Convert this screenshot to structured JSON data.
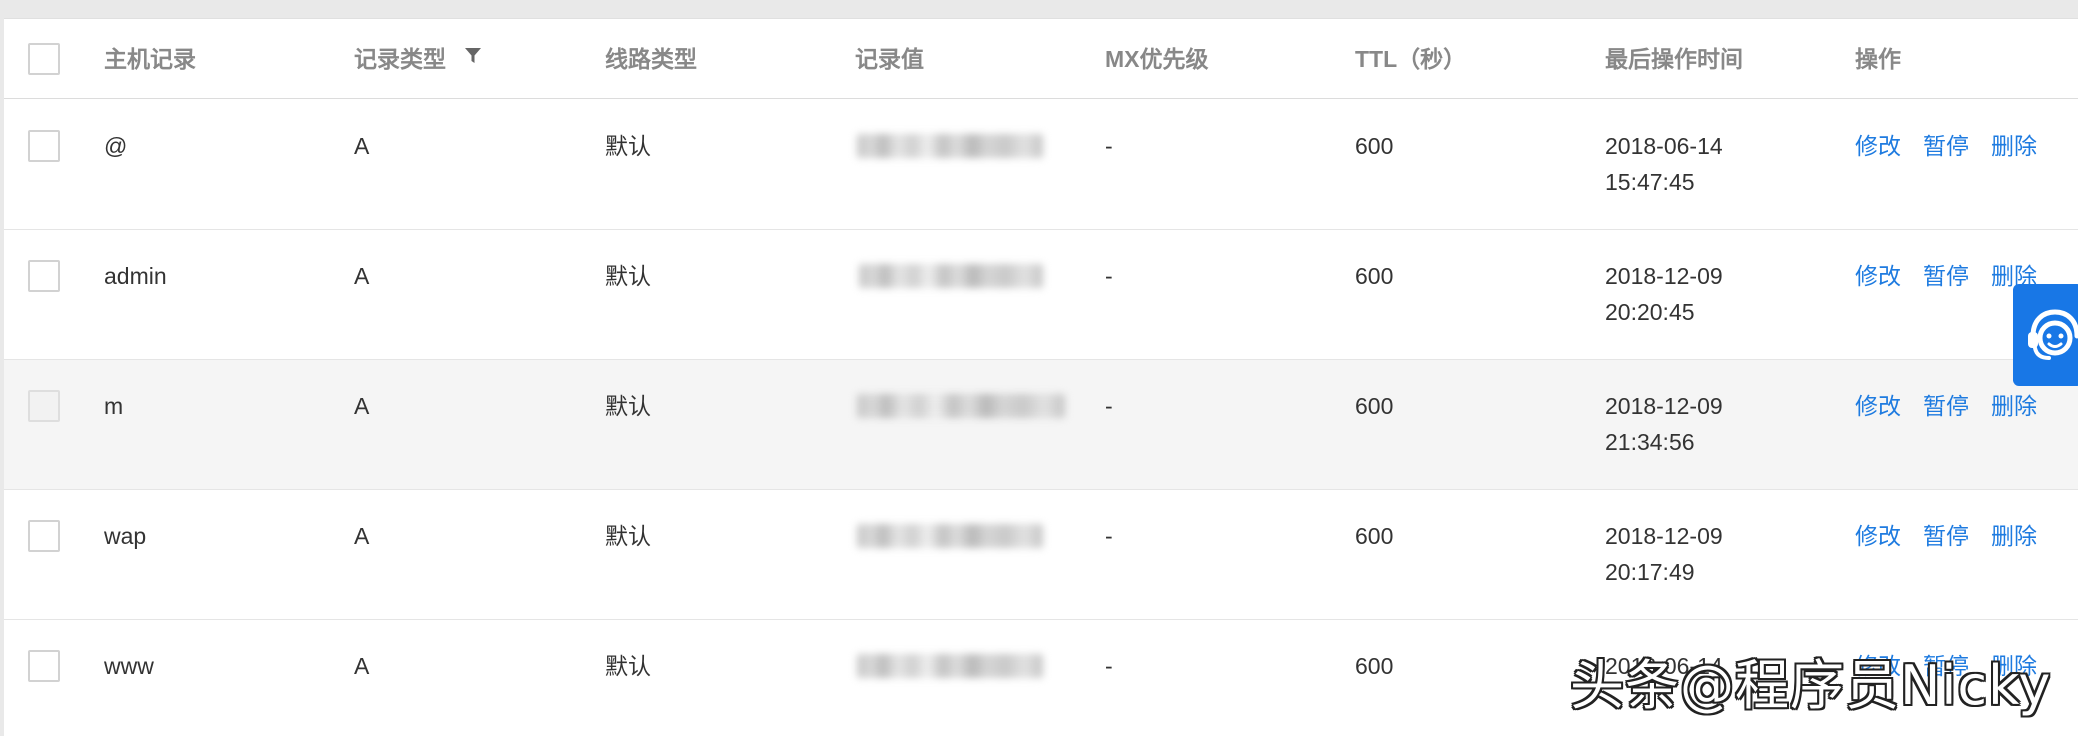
{
  "table": {
    "columns": [
      "主机记录",
      "记录类型",
      "线路类型",
      "记录值",
      "MX优先级",
      "TTL（秒）",
      "最后操作时间",
      "操作"
    ],
    "rows": [
      {
        "host": "@",
        "type": "A",
        "line": "默认",
        "mx": "-",
        "ttl": "600",
        "date": "2018-06-14",
        "time": "15:47:45"
      },
      {
        "host": "admin",
        "type": "A",
        "line": "默认",
        "mx": "-",
        "ttl": "600",
        "date": "2018-12-09",
        "time": "20:20:45"
      },
      {
        "host": "m",
        "type": "A",
        "line": "默认",
        "mx": "-",
        "ttl": "600",
        "date": "2018-12-09",
        "time": "21:34:56"
      },
      {
        "host": "wap",
        "type": "A",
        "line": "默认",
        "mx": "-",
        "ttl": "600",
        "date": "2018-12-09",
        "time": "20:17:49"
      },
      {
        "host": "www",
        "type": "A",
        "line": "默认",
        "mx": "-",
        "ttl": "600",
        "date": "2018-06-14",
        "time": ""
      }
    ],
    "actions": {
      "edit": "修改",
      "pause": "暂停",
      "delete": "删除"
    }
  },
  "icons": {
    "filter": "filter-icon",
    "customer_service": "customer-service-icon"
  },
  "colors": {
    "link": "#1e7be0",
    "service_button": "#1877e6",
    "hover_row": "#f5f5f5"
  },
  "watermark": "头条@程序员Nicky"
}
